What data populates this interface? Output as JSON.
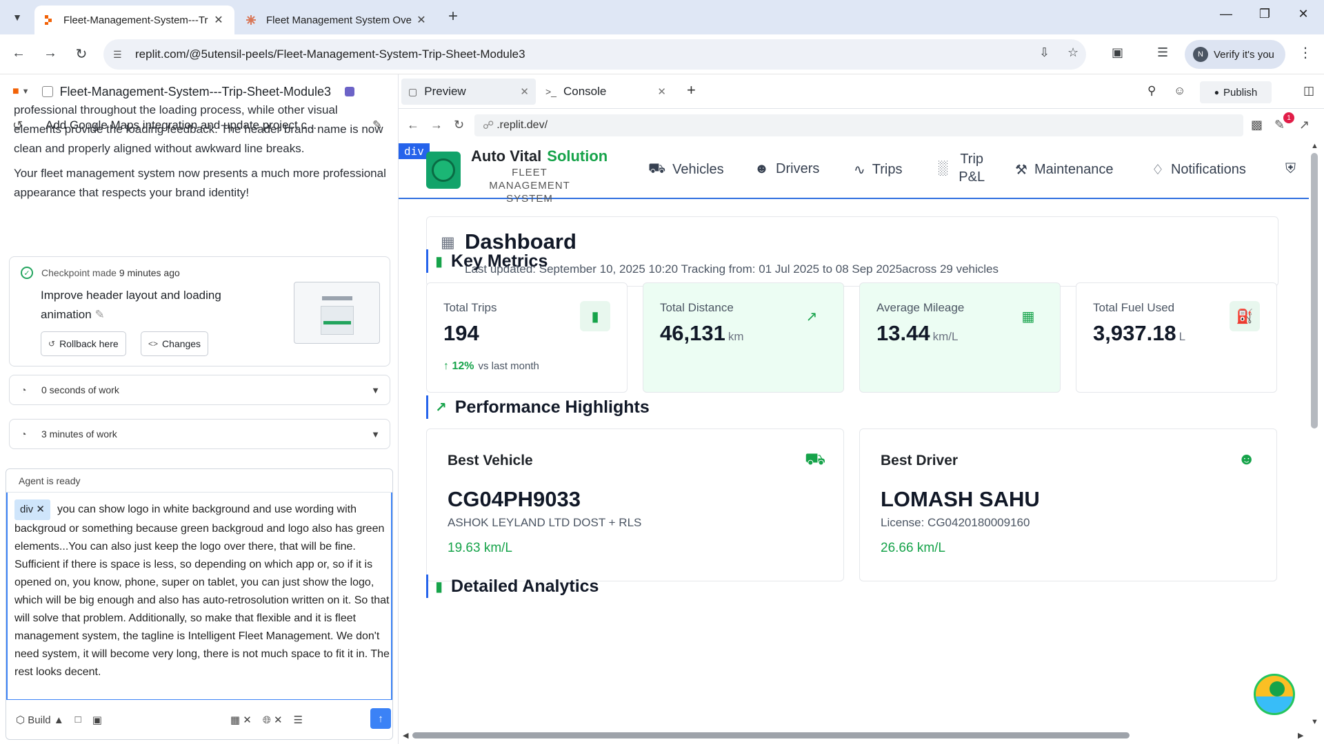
{
  "browser": {
    "tabs": [
      {
        "title": "Fleet-Management-System---Tr",
        "active": true
      },
      {
        "title": "Fleet Management System Ove",
        "active": false
      }
    ],
    "url": "replit.com/@5utensil-peels/Fleet-Management-System-Trip-Sheet-Module3",
    "verify_label": "Verify it's you",
    "avatar_initial": "N"
  },
  "agent": {
    "project_name": "Fleet-Management-System---Trip-Sheet-Module3",
    "thread_title": "Add Google Maps integration and update project c...",
    "message_partial": "professional throughout the loading process, while other visual elements provide the loading feedback. The header brand name is now clean and properly aligned without awkward line breaks.",
    "message_final": "Your fleet management system now presents a much more professional appearance that respects your brand identity!",
    "checkpoint": {
      "made_label": "Checkpoint made",
      "time_ago": "9 minutes ago",
      "title": "Improve header layout and loading animation",
      "rollback_label": "Rollback here",
      "changes_label": "Changes"
    },
    "work_rows": [
      "0 seconds of work",
      "3 minutes of work"
    ],
    "status": "Agent is ready",
    "chip": "div",
    "prompt_text": "you can show logo in white background and use wording with backgroud or something because green backgroud and logo also has green elements...You can also just keep the logo over there, that will be fine. Sufficient if there is space is less, so depending on which app or, so if it is opened on, you know, phone, super on tablet, you can just show the logo, which will be big enough and also has auto-retrosolution written on it. So that will solve that problem. Additionally, so make that flexible and it is fleet management system, the tagline is Intelligent Fleet Management. We don't need system, it will become very long, there is not much space to fit it in. The rest looks decent.",
    "build_label": "Build"
  },
  "workspace": {
    "tabs": [
      "Preview",
      "Console"
    ],
    "publish_label": "Publish",
    "preview_url": ".replit.dev/",
    "badge_count": "1"
  },
  "app": {
    "inspect_tag": "div",
    "brand": {
      "name_a": "Auto Vital",
      "name_b": "Solution",
      "tagline": "FLEET MANAGEMENT SYSTEM"
    },
    "nav": [
      "Vehicles",
      "Drivers",
      "Trips",
      "Trip P&L",
      "Maintenance",
      "Notifications"
    ],
    "dashboard": {
      "title": "Dashboard",
      "subtitle": "Last updated: September 10, 2025 10:20    Tracking from: 01 Jul 2025 to 08 Sep 2025across 29 vehicles"
    },
    "key_metrics_title": "Key Metrics",
    "metrics": [
      {
        "label": "Total Trips",
        "value": "194",
        "unit": "",
        "trend_pct": "12%",
        "trend_text": "vs last month",
        "icon": "bar-chart-icon"
      },
      {
        "label": "Total Distance",
        "value": "46,131",
        "unit": "km",
        "icon": "trending-up-icon"
      },
      {
        "label": "Average Mileage",
        "value": "13.44",
        "unit": "km/L",
        "icon": "calculator-icon"
      },
      {
        "label": "Total Fuel Used",
        "value": "3,937.18",
        "unit": "L",
        "icon": "fuel-pump-icon"
      }
    ],
    "highlights_title": "Performance Highlights",
    "best_vehicle": {
      "title": "Best Vehicle",
      "id": "CG04PH9033",
      "detail": "ASHOK LEYLAND LTD DOST + RLS",
      "stat": "19.63 km/L"
    },
    "best_driver": {
      "title": "Best Driver",
      "name": "LOMASH SAHU",
      "detail": "License: CG0420180009160",
      "stat": "26.66 km/L"
    },
    "analytics_title": "Detailed Analytics"
  },
  "colors": {
    "accent_green": "#16a34a",
    "accent_blue": "#2563eb",
    "tint_green": "#ecfdf3"
  }
}
